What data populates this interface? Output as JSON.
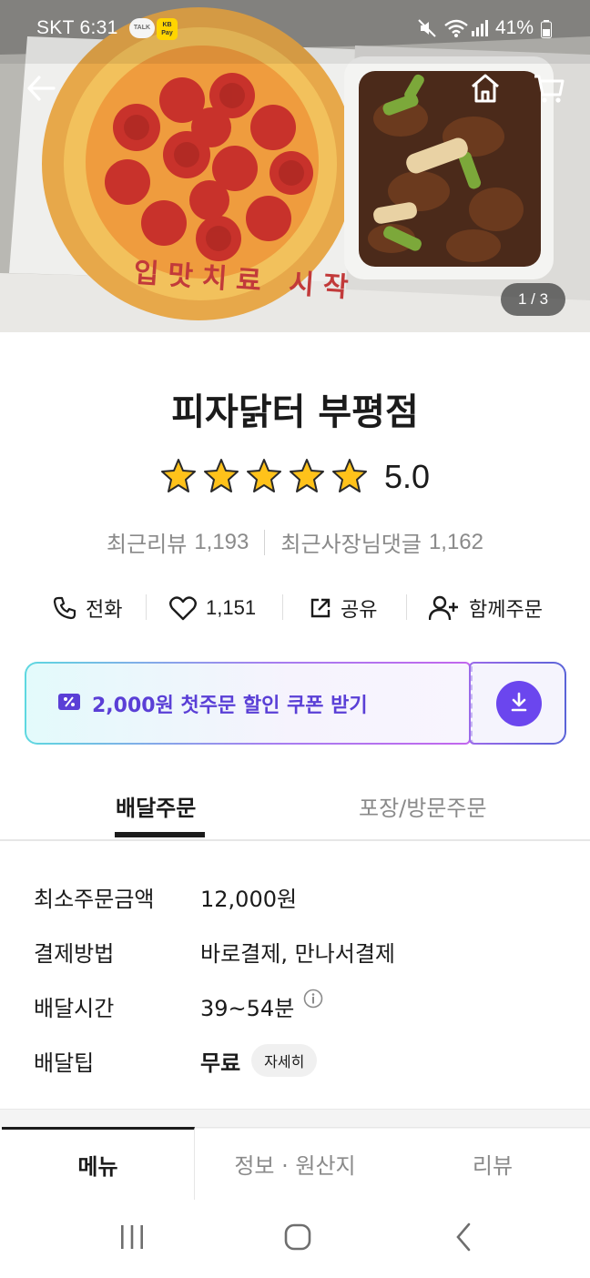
{
  "status_bar": {
    "carrier_time": "SKT 6:31",
    "talk_badge": "TALK",
    "kpay_badge": "KB Pay",
    "battery": "41%",
    "icons": [
      "mute-icon",
      "wifi-icon",
      "signal-icon",
      "battery-icon"
    ]
  },
  "hero": {
    "box_text": "입맛치료 시작",
    "page_indicator": "1 / 3",
    "icons": [
      "back-arrow-icon",
      "home-icon",
      "cart-icon"
    ]
  },
  "store": {
    "name": "피자닭터 부평점",
    "rating": "5.0",
    "stars": 5,
    "recent_reviews_label": "최근리뷰",
    "recent_reviews_count": "1,193",
    "owner_replies_label": "최근사장님댓글",
    "owner_replies_count": "1,162"
  },
  "actions": {
    "call": "전화",
    "likes": "1,151",
    "share": "공유",
    "group_order": "함께주문"
  },
  "coupon": {
    "label": "2,000원 첫주문 할인 쿠폰 받기",
    "colors": {
      "accent": "#6b46ee",
      "text": "#5a3fd6"
    }
  },
  "order_tabs": {
    "delivery": "배달주문",
    "pickup": "포장/방문주문",
    "selected": "delivery"
  },
  "delivery_info": {
    "rows": [
      {
        "key": "최소주문금액",
        "value": "12,000원"
      },
      {
        "key": "결제방법",
        "value": "바로결제, 만나서결제"
      },
      {
        "key": "배달시간",
        "value": "39~54분"
      },
      {
        "key": "배달팁",
        "value": "무료",
        "chip": "자세히"
      }
    ]
  },
  "menu_tabs": {
    "menu": "메뉴",
    "info": "정보 · 원산지",
    "reviews": "리뷰",
    "selected": "menu"
  },
  "colors": {
    "star": "#ffc21a",
    "primary_text": "#1b1b1b",
    "secondary_text": "#8a8a8a"
  }
}
